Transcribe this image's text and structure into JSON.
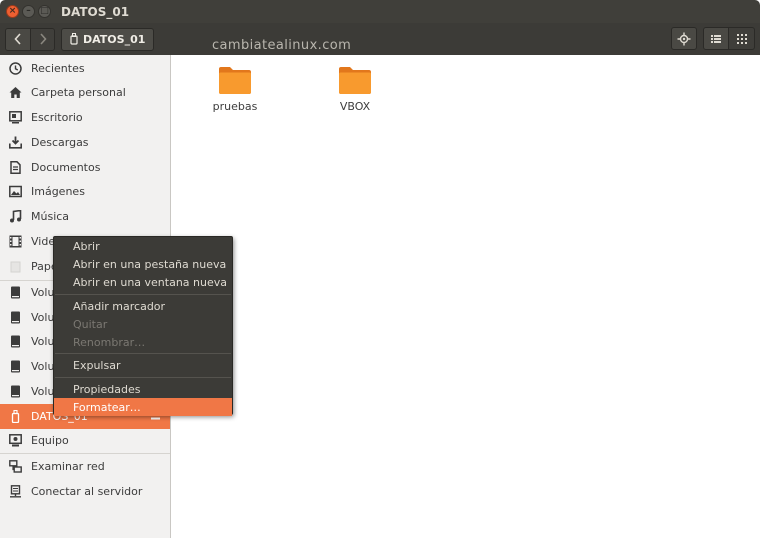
{
  "window": {
    "title": "DATOS_01",
    "controls": {
      "close": "×",
      "minimize": "–",
      "maximize": "□"
    }
  },
  "toolbar": {
    "back_icon": "chevron-left",
    "forward_icon": "chevron-right",
    "path_label": "DATOS_01",
    "watermark": "cambiatealinux.com",
    "location_icon": "locate-icon",
    "view_list_icon": "list-icon",
    "view_grid_icon": "grid-icon"
  },
  "sidebar": {
    "items": [
      {
        "label": "Recientes",
        "icon": "clock-icon"
      },
      {
        "label": "Carpeta personal",
        "icon": "home-icon"
      },
      {
        "label": "Escritorio",
        "icon": "desktop-icon"
      },
      {
        "label": "Descargas",
        "icon": "download-icon"
      },
      {
        "label": "Documentos",
        "icon": "document-icon"
      },
      {
        "label": "Imágenes",
        "icon": "image-icon"
      },
      {
        "label": "Música",
        "icon": "music-icon"
      },
      {
        "label": "Vide",
        "icon": "video-icon"
      },
      {
        "label": "Pape",
        "icon": "trash-icon"
      },
      {
        "label": "Volu",
        "icon": "drive-icon"
      },
      {
        "label": "Volu",
        "icon": "drive-icon"
      },
      {
        "label": "Volu",
        "icon": "drive-icon"
      },
      {
        "label": "Volu",
        "icon": "drive-icon"
      },
      {
        "label": "Volu",
        "icon": "drive-icon"
      },
      {
        "label": "DATOS_01",
        "icon": "usb-icon",
        "active": true
      },
      {
        "label": "Equipo",
        "icon": "computer-icon"
      },
      {
        "label": "Examinar red",
        "icon": "network-icon"
      },
      {
        "label": "Conectar al servidor",
        "icon": "server-icon"
      }
    ]
  },
  "main": {
    "folders": [
      {
        "name": "pruebas"
      },
      {
        "name": "VBOX"
      }
    ]
  },
  "context_menu": {
    "items": [
      {
        "label": "Abrir",
        "enabled": true
      },
      {
        "label": "Abrir en una pestaña nueva",
        "enabled": true
      },
      {
        "label": "Abrir en una ventana nueva",
        "enabled": true
      },
      {
        "label": "Añadir marcador",
        "enabled": true
      },
      {
        "label": "Quitar",
        "enabled": false
      },
      {
        "label": "Renombrar…",
        "enabled": false
      },
      {
        "label": "Expulsar",
        "enabled": true
      },
      {
        "label": "Propiedades",
        "enabled": true
      },
      {
        "label": "Formatear…",
        "enabled": true,
        "highlighted": true
      }
    ]
  },
  "colors": {
    "accent": "#f07746",
    "titlebar": "#403f3a",
    "menu_bg": "#3c3b37",
    "folder": "#f89a2e"
  }
}
